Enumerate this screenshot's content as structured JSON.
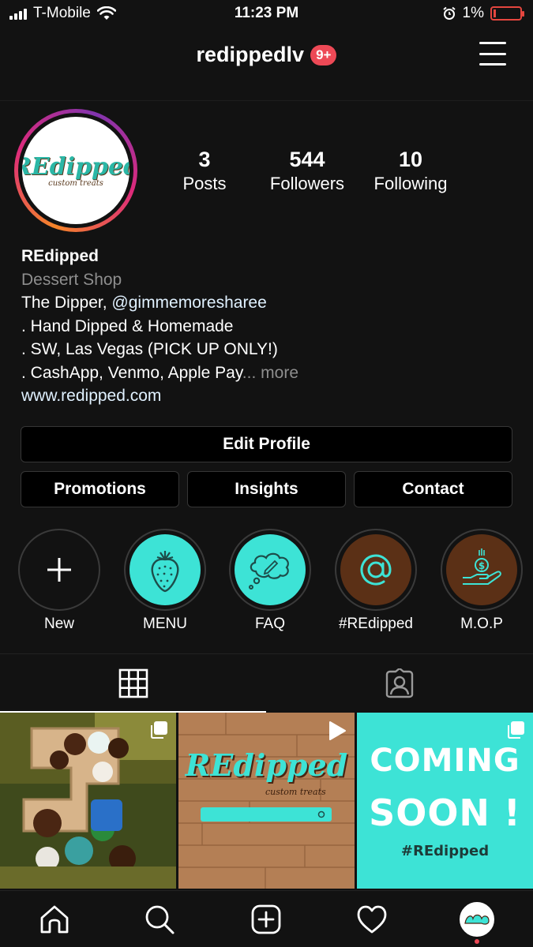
{
  "status_bar": {
    "carrier": "T-Mobile",
    "time": "11:23 PM",
    "battery": "1%"
  },
  "header": {
    "username": "redippedlv",
    "notification_count": "9+"
  },
  "profile": {
    "avatar_text": "REdipped",
    "avatar_subtext": "custom treats",
    "stats": [
      {
        "value": "3",
        "label": "Posts"
      },
      {
        "value": "544",
        "label": "Followers"
      },
      {
        "value": "10",
        "label": "Following"
      }
    ],
    "name": "REdipped",
    "category": "Dessert Shop",
    "bio_prefix": "The Dipper, ",
    "bio_mention": "@gimmemoresharee",
    "bio_line2": ". Hand Dipped & Homemade",
    "bio_line3": ". SW, Las Vegas (PICK UP ONLY!)",
    "bio_line4": ". CashApp, Venmo, Apple Pay",
    "bio_ellipsis": "...",
    "bio_more": " more",
    "website": "www.redipped.com"
  },
  "buttons": {
    "edit_profile": "Edit Profile",
    "promotions": "Promotions",
    "insights": "Insights",
    "contact": "Contact"
  },
  "highlights": [
    {
      "label": "New",
      "icon": "plus-icon"
    },
    {
      "label": "MENU",
      "icon": "strawberry-icon"
    },
    {
      "label": "FAQ",
      "icon": "thought-bubble-icon"
    },
    {
      "label": "#REdipped",
      "icon": "at-sign-icon"
    },
    {
      "label": "M.O.P",
      "icon": "hand-money-icon"
    }
  ],
  "tabs": [
    {
      "name": "grid",
      "icon": "grid-icon",
      "active": true
    },
    {
      "name": "tagged",
      "icon": "tagged-person-icon",
      "active": false
    }
  ],
  "posts": [
    {
      "type": "carousel",
      "icon": "multi-photo-icon"
    },
    {
      "type": "video",
      "icon": "play-icon",
      "title": "REdipped",
      "subtitle": "custom treats"
    },
    {
      "type": "carousel",
      "icon": "multi-photo-icon",
      "line1": "COMING",
      "line2": "SOON !",
      "hashtag": "#REdipped"
    }
  ],
  "bottom_nav": [
    "home-icon",
    "search-icon",
    "new-post-icon",
    "activity-heart-icon",
    "profile-avatar-icon"
  ],
  "colors": {
    "background": "#121212",
    "accent_teal": "#3de3d6",
    "badge_red": "#ed4956",
    "chocolate": "#5b3016"
  }
}
